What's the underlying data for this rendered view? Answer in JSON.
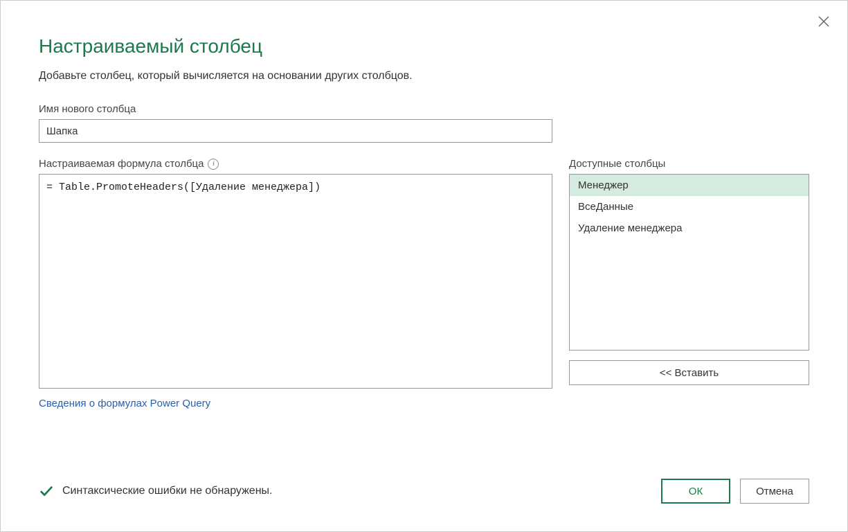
{
  "dialog": {
    "title": "Настраиваемый столбец",
    "subtitle": "Добавьте столбец, который вычисляется на основании других столбцов."
  },
  "name_field": {
    "label": "Имя нового столбца",
    "value": "Шапка"
  },
  "formula_field": {
    "label": "Настраиваемая формула столбца",
    "value": "= Table.PromoteHeaders([Удаление менеджера])"
  },
  "columns_field": {
    "label": "Доступные столбцы",
    "items": [
      "Менеджер",
      "ВсеДанные",
      "Удаление менеджера"
    ],
    "selected_index": 0,
    "insert_label": "<< Вставить"
  },
  "link": {
    "label": "Сведения о формулах Power Query"
  },
  "status": {
    "text": "Синтаксические ошибки не обнаружены."
  },
  "buttons": {
    "ok": "ОК",
    "cancel": "Отмена"
  }
}
